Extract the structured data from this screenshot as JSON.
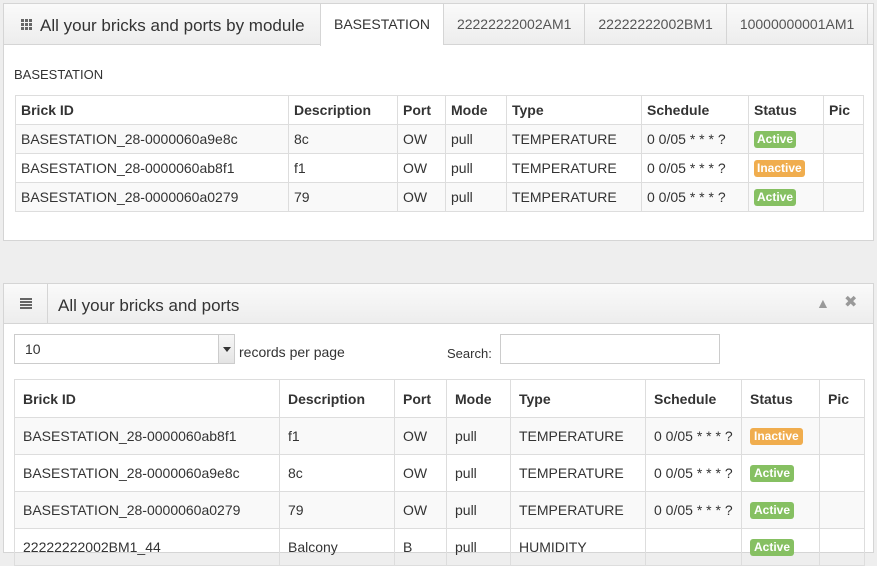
{
  "modules_widget": {
    "title": "All your bricks and ports by module",
    "tabs": [
      {
        "label": "BASESTATION",
        "active": true
      },
      {
        "label": "22222222002AM1",
        "active": false
      },
      {
        "label": "22222222002BM1",
        "active": false
      },
      {
        "label": "10000000001AM1",
        "active": false
      }
    ],
    "section_label": "BASESTATION",
    "columns": [
      "Brick ID",
      "Description",
      "Port",
      "Mode",
      "Type",
      "Schedule",
      "Status",
      "Pic"
    ],
    "rows": [
      {
        "brick_id": "BASESTATION_28-0000060a9e8c",
        "description": "8c",
        "port": "OW",
        "mode": "pull",
        "type": "TEMPERATURE",
        "schedule": "0 0/05 * * * ?",
        "status": "Active",
        "pic": ""
      },
      {
        "brick_id": "BASESTATION_28-0000060ab8f1",
        "description": "f1",
        "port": "OW",
        "mode": "pull",
        "type": "TEMPERATURE",
        "schedule": "0 0/05 * * * ?",
        "status": "Inactive",
        "pic": ""
      },
      {
        "brick_id": "BASESTATION_28-0000060a0279",
        "description": "79",
        "port": "OW",
        "mode": "pull",
        "type": "TEMPERATURE",
        "schedule": "0 0/05 * * * ?",
        "status": "Active",
        "pic": ""
      }
    ]
  },
  "all_widget": {
    "title": "All your bricks and ports",
    "records_per_page": "10",
    "records_label": "records per page",
    "search_label": "Search:",
    "search_value": "",
    "columns": [
      "Brick ID",
      "Description",
      "Port",
      "Mode",
      "Type",
      "Schedule",
      "Status",
      "Pic"
    ],
    "rows": [
      {
        "brick_id": "BASESTATION_28-0000060ab8f1",
        "description": "f1",
        "port": "OW",
        "mode": "pull",
        "type": "TEMPERATURE",
        "schedule": "0 0/05 * * * ?",
        "status": "Inactive",
        "pic": ""
      },
      {
        "brick_id": "BASESTATION_28-0000060a9e8c",
        "description": "8c",
        "port": "OW",
        "mode": "pull",
        "type": "TEMPERATURE",
        "schedule": "0 0/05 * * * ?",
        "status": "Active",
        "pic": ""
      },
      {
        "brick_id": "BASESTATION_28-0000060a0279",
        "description": "79",
        "port": "OW",
        "mode": "pull",
        "type": "TEMPERATURE",
        "schedule": "0 0/05 * * * ?",
        "status": "Active",
        "pic": ""
      },
      {
        "brick_id": "22222222002BM1_44",
        "description": "Balcony",
        "port": "B",
        "mode": "pull",
        "type": "HUMIDITY",
        "schedule": "",
        "status": "Active",
        "pic": ""
      }
    ]
  },
  "colors": {
    "active": "#86c062",
    "inactive": "#f0ad4e"
  },
  "icons": {
    "modules_widget": "grid-icon",
    "all_widget": "list-icon",
    "collapse": "chevron-up-icon",
    "close": "close-icon"
  }
}
